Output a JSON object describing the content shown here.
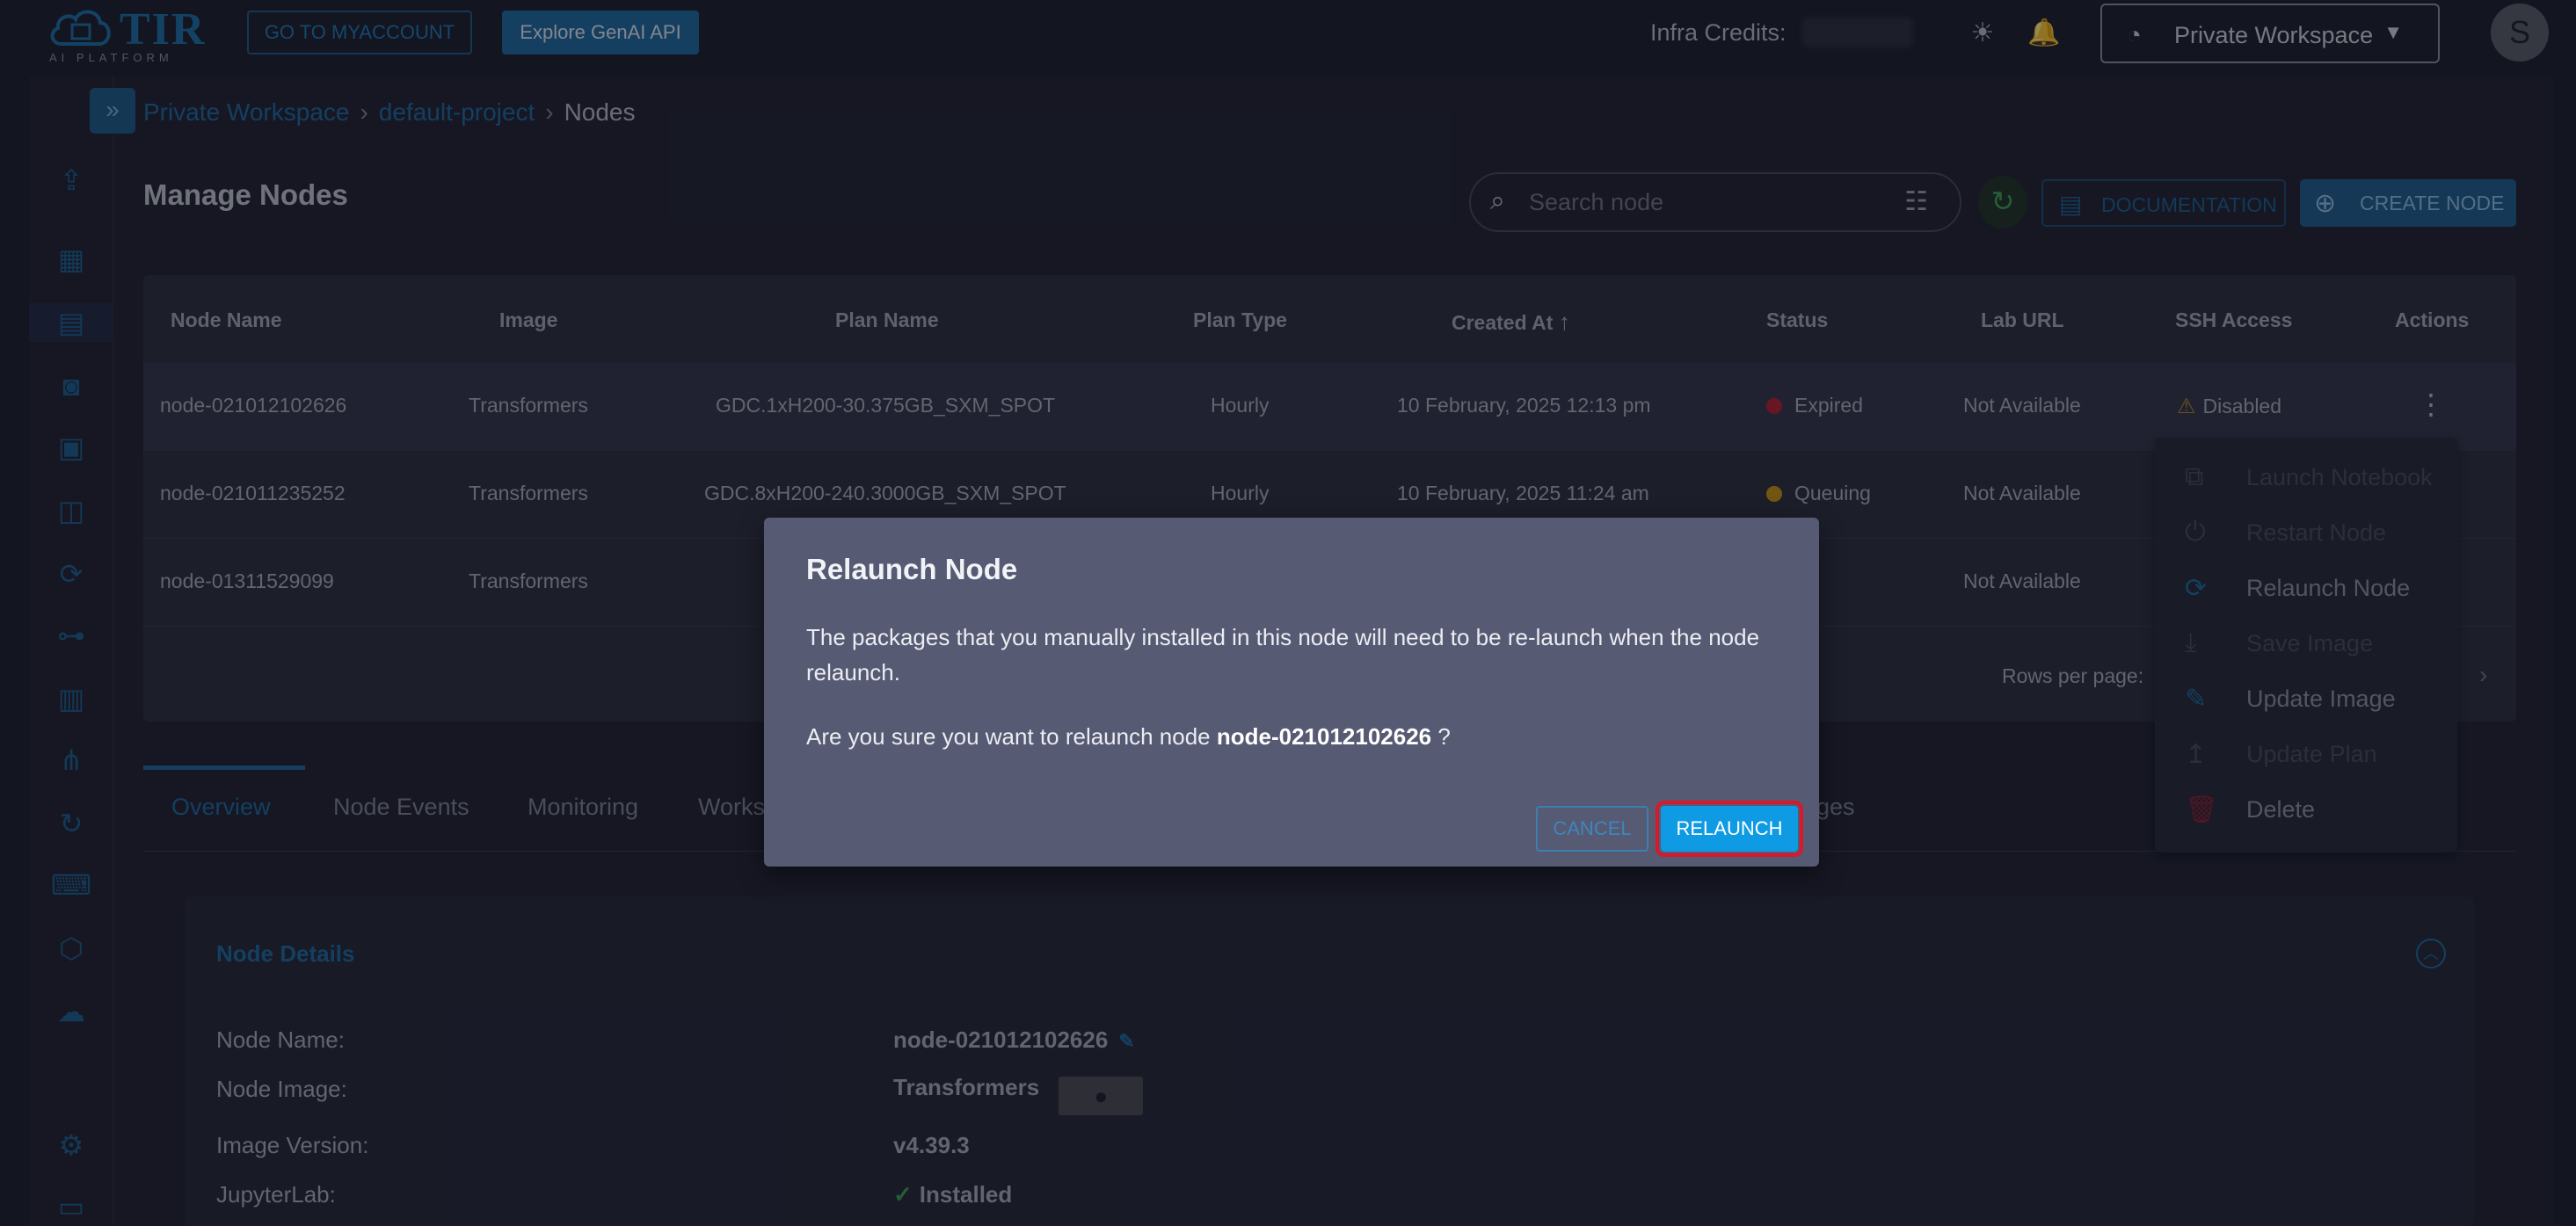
{
  "topbar": {
    "logo_text": "TIR",
    "logo_sub": "AI PLATFORM",
    "myaccount_label": "GO TO MYACCOUNT",
    "genai_label": "Explore GenAI API",
    "credits_label": "Infra Credits:",
    "workspace_label": "Private Workspace",
    "avatar_initial": "S"
  },
  "breadcrumb": {
    "items": [
      "Private Workspace",
      "default-project",
      "Nodes"
    ],
    "separator": "›"
  },
  "page": {
    "title": "Manage Nodes",
    "search_placeholder": "Search node",
    "documentation_label": "DOCUMENTATION",
    "create_label": "CREATE NODE"
  },
  "table": {
    "headers": [
      "Node Name",
      "Image",
      "Plan Name",
      "Plan Type",
      "Created At",
      "Status",
      "Lab URL",
      "SSH Access",
      "Actions"
    ],
    "rows": [
      {
        "name": "node-021012102626",
        "image": "Transformers",
        "plan": "GDC.1xH200-30.375GB_SXM_SPOT",
        "plan_type": "Hourly",
        "created": "10 February, 2025 12:13 pm",
        "status": "Expired",
        "lab_url": "Not Available",
        "ssh": "Disabled"
      },
      {
        "name": "node-021011235252",
        "image": "Transformers",
        "plan": "GDC.8xH200-240.3000GB_SXM_SPOT",
        "plan_type": "Hourly",
        "created": "10 February, 2025 11:24 am",
        "status": "Queuing",
        "lab_url": "Not Available",
        "ssh": ""
      },
      {
        "name": "node-01311529099",
        "image": "Transformers",
        "plan": "",
        "plan_type": "",
        "created": "",
        "status": "",
        "lab_url": "Not Available",
        "ssh": ""
      }
    ],
    "rows_per_page_label": "Rows per page:"
  },
  "tabs": [
    "Overview",
    "Node Events",
    "Monitoring",
    "Works",
    "ages"
  ],
  "details": {
    "title": "Node Details",
    "fields": [
      {
        "label": "Node Name:",
        "value": "node-021012102626"
      },
      {
        "label": "Node Image:",
        "value": "Transformers"
      },
      {
        "label": "Image Version:",
        "value": "v4.39.3"
      },
      {
        "label": "JupyterLab:",
        "value": "Installed"
      }
    ]
  },
  "actions_menu": {
    "items": [
      {
        "label": "Launch Notebook",
        "enabled": false
      },
      {
        "label": "Restart Node",
        "enabled": false
      },
      {
        "label": "Relaunch Node",
        "enabled": true
      },
      {
        "label": "Save Image",
        "enabled": false
      },
      {
        "label": "Update Image",
        "enabled": true
      },
      {
        "label": "Update Plan",
        "enabled": false
      },
      {
        "label": "Delete",
        "enabled": true
      }
    ]
  },
  "dialog": {
    "title": "Relaunch Node",
    "message": "The packages that you manually installed in this node will need to be re-launch when the node relaunch.",
    "question_prefix": "Are you sure you want to relaunch node",
    "node_name": "node-021012102626",
    "question_suffix": "?",
    "cancel_label": "CANCEL",
    "confirm_label": "RELAUNCH"
  },
  "colors": {
    "accent": "#1d6aa0",
    "confirm_button": "#0f9be3",
    "highlight_outline": "#d9182b",
    "status_expired": "#b3202e",
    "status_queuing": "#c9920f"
  }
}
